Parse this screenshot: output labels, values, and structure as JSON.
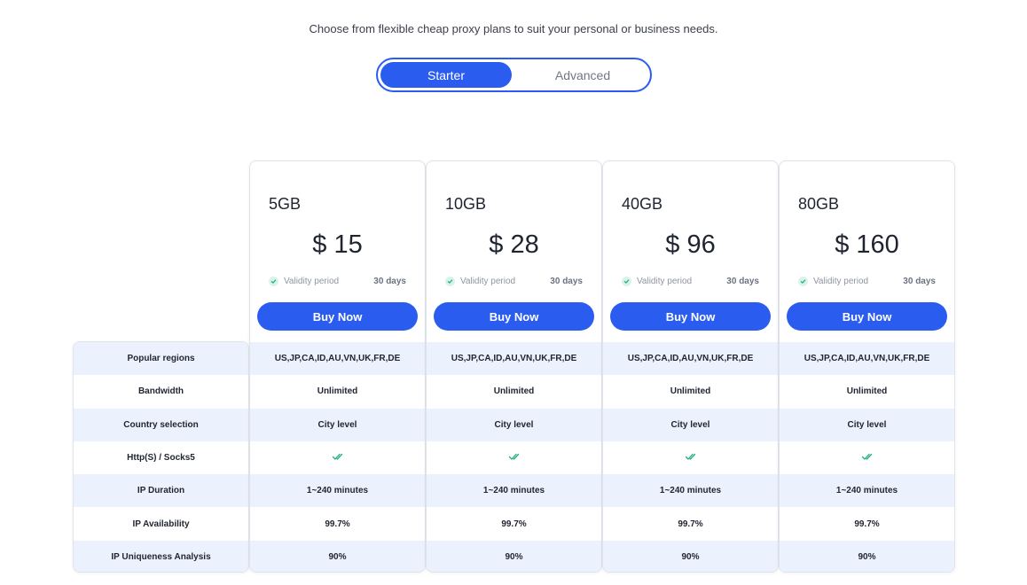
{
  "header": {
    "subtitle": "Choose from flexible cheap proxy plans to suit your personal or business needs."
  },
  "toggle": {
    "options": [
      "Starter",
      "Advanced"
    ],
    "selected": "Starter"
  },
  "features": [
    "Popular regions",
    "Bandwidth",
    "Country selection",
    "Http(S) / Socks5",
    "IP Duration",
    "IP Availability",
    "IP Uniqueness Analysis"
  ],
  "plans": [
    {
      "size": "5GB",
      "price": "$ 15",
      "validity_label": "Validity period",
      "validity_value": "30 days",
      "buy_label": "Buy Now",
      "values": [
        "US,JP,CA,ID,AU,VN,UK,FR,DE",
        "Unlimited",
        "City level",
        "double-check-icon",
        "1~240 minutes",
        "99.7%",
        "90%"
      ]
    },
    {
      "size": "10GB",
      "price": "$ 28",
      "validity_label": "Validity period",
      "validity_value": "30 days",
      "buy_label": "Buy Now",
      "values": [
        "US,JP,CA,ID,AU,VN,UK,FR,DE",
        "Unlimited",
        "City level",
        "double-check-icon",
        "1~240 minutes",
        "99.7%",
        "90%"
      ]
    },
    {
      "size": "40GB",
      "price": "$ 96",
      "validity_label": "Validity period",
      "validity_value": "30 days",
      "buy_label": "Buy Now",
      "values": [
        "US,JP,CA,ID,AU,VN,UK,FR,DE",
        "Unlimited",
        "City level",
        "double-check-icon",
        "1~240 minutes",
        "99.7%",
        "90%"
      ]
    },
    {
      "size": "80GB",
      "price": "$ 160",
      "validity_label": "Validity period",
      "validity_value": "30 days",
      "buy_label": "Buy Now",
      "values": [
        "US,JP,CA,ID,AU,VN,UK,FR,DE",
        "Unlimited",
        "City level",
        "double-check-icon",
        "1~240 minutes",
        "99.7%",
        "90%"
      ]
    }
  ],
  "colors": {
    "accent": "#2a5cf0",
    "row_shade": "#ecf2fd",
    "check_green": "#22b07d"
  }
}
